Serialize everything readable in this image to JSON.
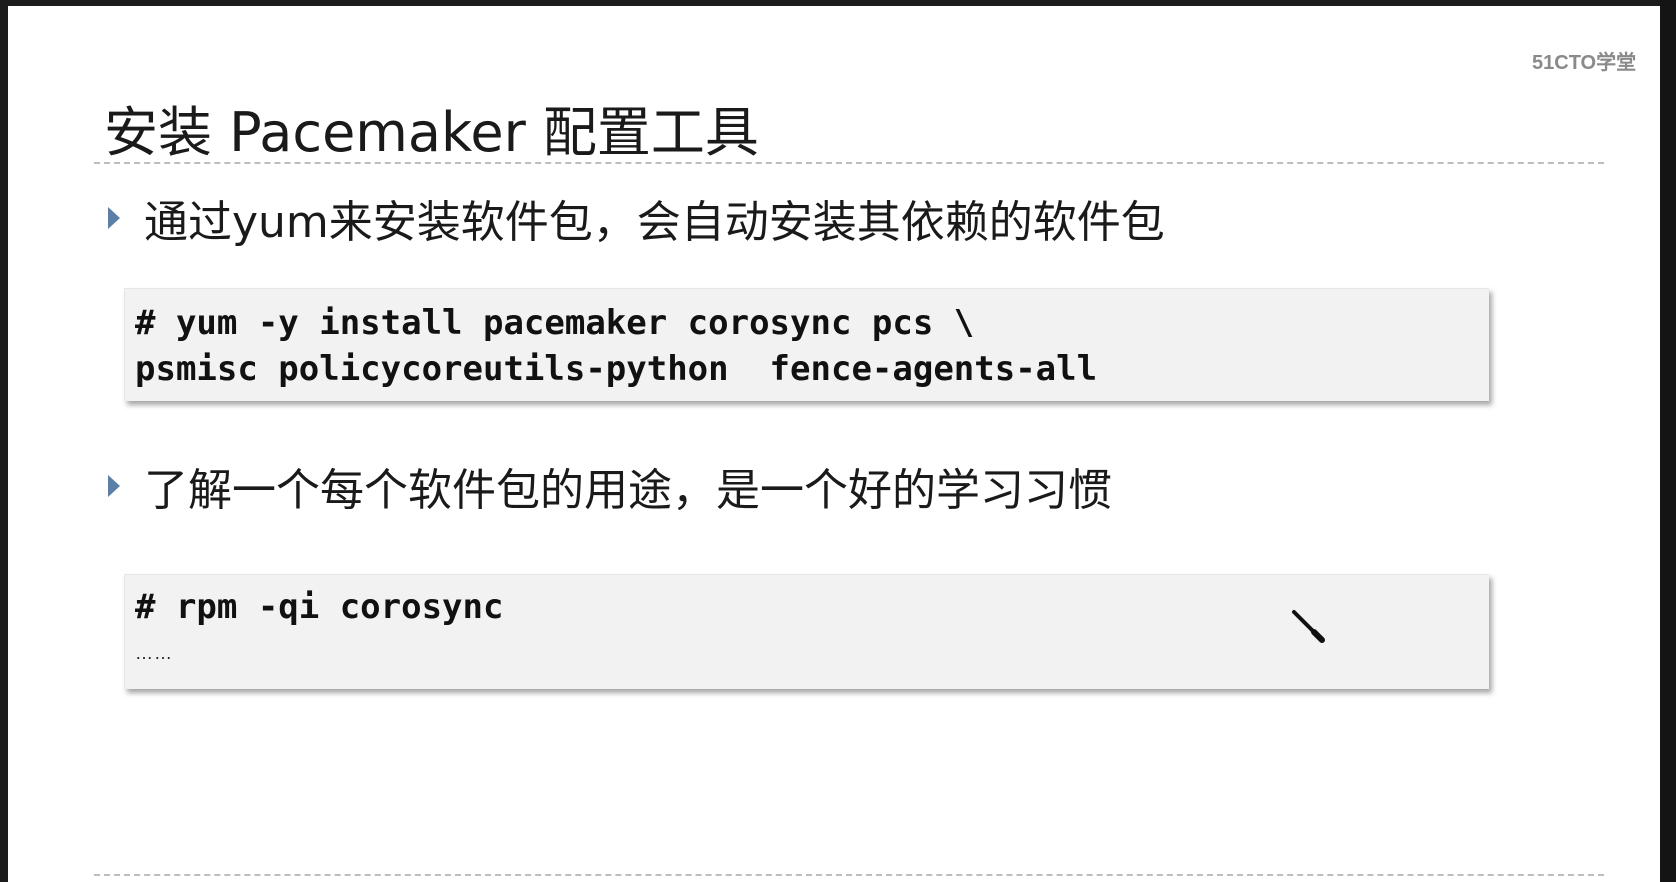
{
  "slide": {
    "logo": "51CTO学堂",
    "title": "安装 Pacemaker 配置工具",
    "bullets": [
      {
        "text": "通过yum来安装软件包，会自动安装其依赖的软件包"
      },
      {
        "text": "了解一个每个软件包的用途，是一个好的学习习惯"
      }
    ],
    "code_blocks": [
      {
        "lines": [
          "# yum -y install pacemaker corosync pcs \\",
          "psmisc policycoreutils-python  fence-agents-all"
        ]
      },
      {
        "lines": [
          "# rpm -qi corosync"
        ],
        "ellipsis": "……"
      }
    ]
  },
  "colors": {
    "bullet_arrow": "#5b7fa6",
    "code_background": "#f2f2f2",
    "logo": "#8a8a8a"
  },
  "icons": {
    "bullet": "triangle-right-icon",
    "pointer": "pen-cursor-icon"
  }
}
